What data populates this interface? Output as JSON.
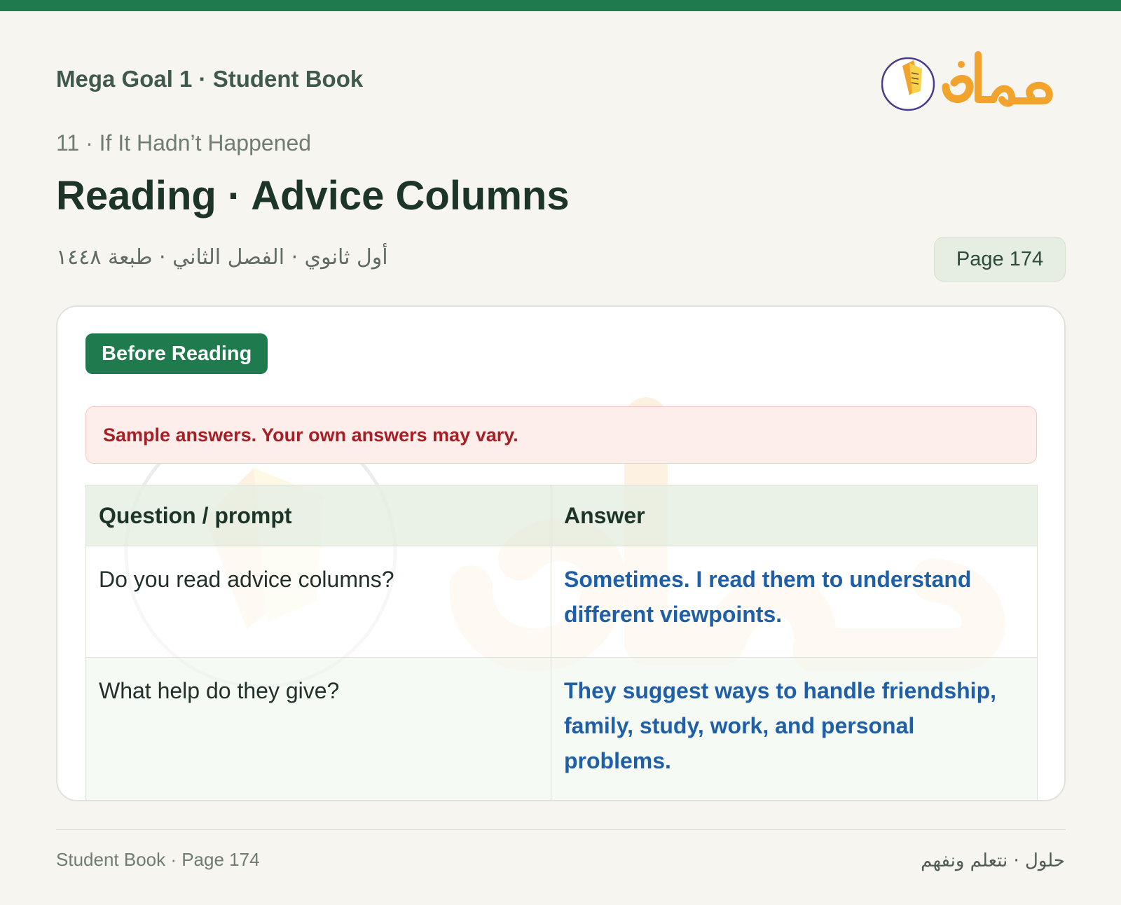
{
  "header": {
    "book_title": "Mega Goal 1 · Student Book",
    "unit_line": "11 · If It Hadn’t Happened",
    "page_heading": "Reading · Advice Columns",
    "arabic_subtitle": "أول ثانوي · الفصل الثاني · طبعة ١٤٤٨",
    "page_badge": "Page 174",
    "logo_icon": "book-page-logo-icon"
  },
  "card": {
    "section_label": "Before Reading",
    "notice": "Sample answers. Your own answers may vary.",
    "table": {
      "headers": [
        "Question / prompt",
        "Answer"
      ],
      "rows": [
        {
          "question": "Do you read advice columns?",
          "answer": "Sometimes. I read them to understand different viewpoints."
        },
        {
          "question": "What help do they give?",
          "answer": "They suggest ways to handle friendship, family, study, work, and personal problems."
        }
      ]
    }
  },
  "footer": {
    "left": "Student Book · Page 174",
    "right": "حلول · نتعلم ونفهم"
  },
  "colors": {
    "accent_green": "#1f7a4d",
    "answer_blue": "#1f5fa8",
    "notice_red": "#a51f24",
    "logo_orange": "#f2a32c"
  }
}
